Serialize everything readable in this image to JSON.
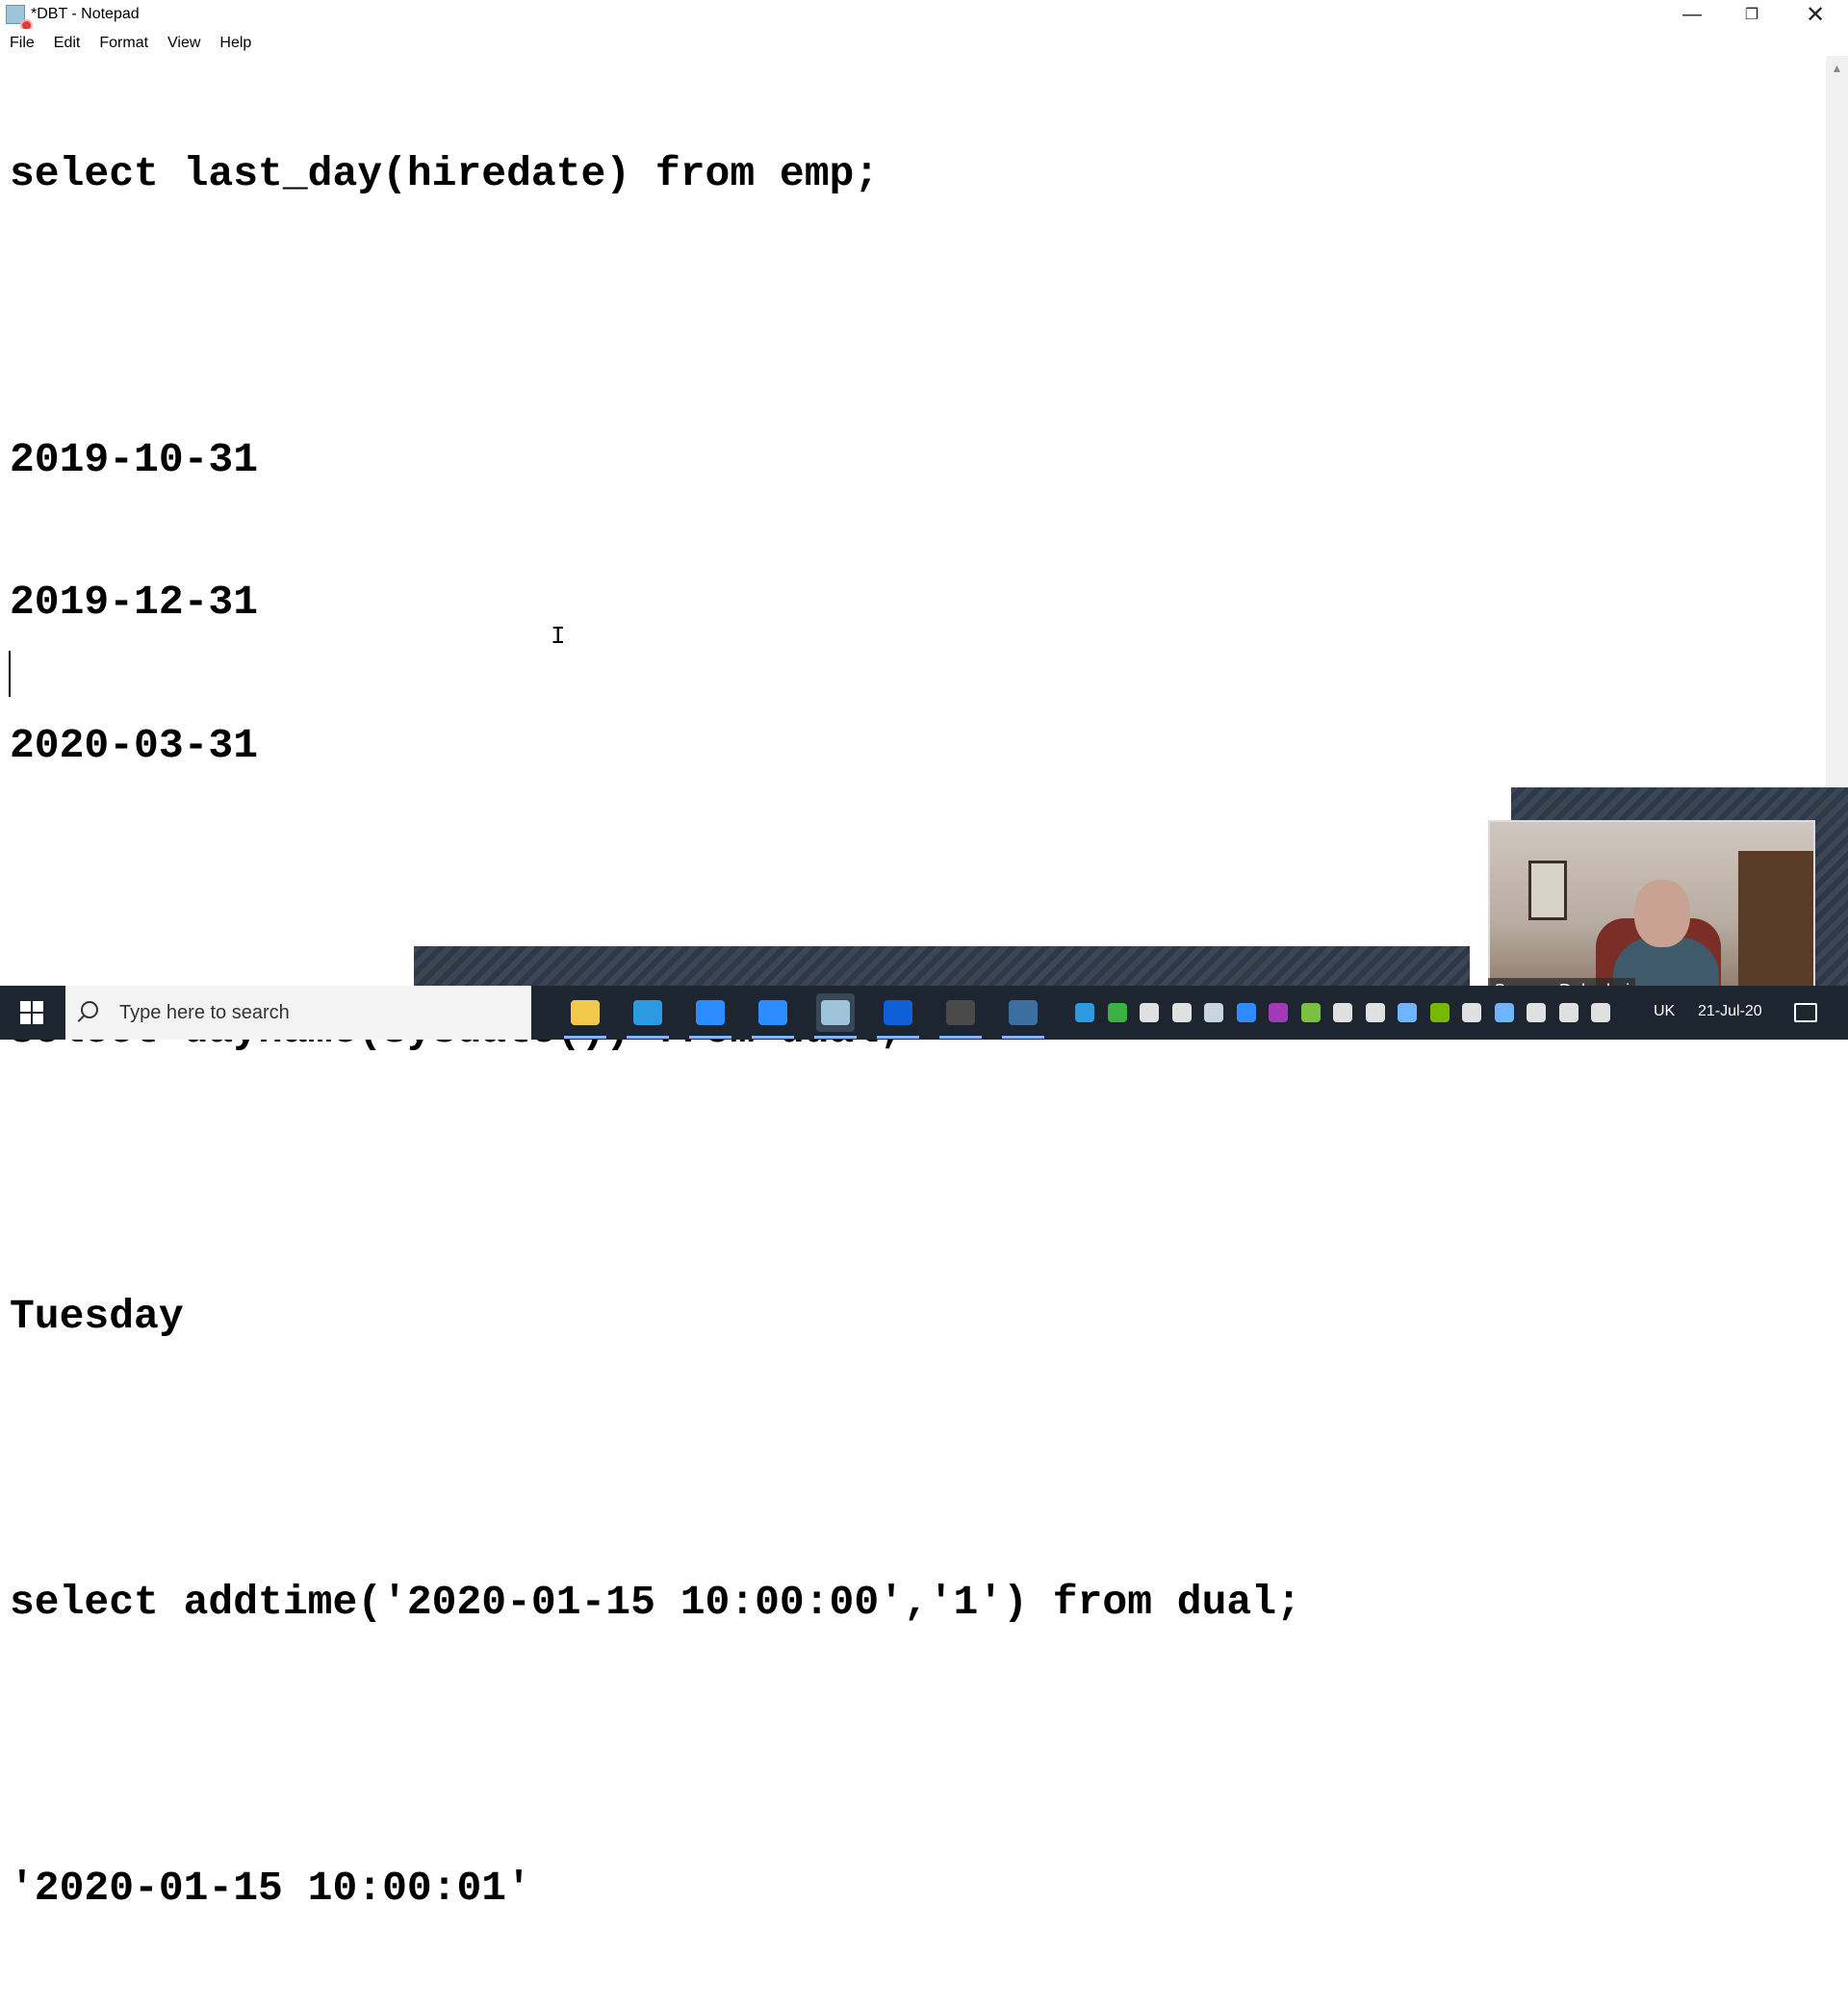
{
  "window": {
    "title": "*DBT - Notepad",
    "minimize_glyph": "—",
    "restore_glyph": "❐",
    "close_glyph": "✕"
  },
  "menu": [
    {
      "label": "File"
    },
    {
      "label": "Edit"
    },
    {
      "label": "Format"
    },
    {
      "label": "View"
    },
    {
      "label": "Help"
    }
  ],
  "editor": {
    "lines": [
      "select last_day(hiredate) from emp;",
      "",
      "2019-10-31",
      "2019-12-31",
      "2020-03-31",
      "",
      "select dayname(sysdate()) from dual;",
      "",
      "Tuesday",
      "",
      "select addtime('2020-01-15 10:00:00','1') from dual;",
      "",
      "'2020-01-15 10:00:01'"
    ]
  },
  "webcam": {
    "participant_name": "Sameer Dehadrai"
  },
  "taskbar": {
    "search_placeholder": "Type here to search",
    "apps": [
      {
        "icon": "file-explorer-icon",
        "color": "#f2c94c"
      },
      {
        "icon": "edge-icon",
        "color": "#2b9ae0"
      },
      {
        "icon": "zoom-icon",
        "color": "#2d8cff"
      },
      {
        "icon": "zoom-meetings-icon",
        "color": "#2d8cff"
      },
      {
        "icon": "notepad-icon",
        "color": "#9fc3d8",
        "active": true
      },
      {
        "icon": "whiteboard-icon",
        "color": "#0f5fd6"
      },
      {
        "icon": "sql-terminal-icon",
        "color": "#4a4a4a"
      },
      {
        "icon": "mysql-workbench-icon",
        "color": "#3b6fa0"
      }
    ],
    "tray_icons": [
      {
        "icon": "help-icon",
        "color": "#2b9ae0"
      },
      {
        "icon": "check-shield-icon",
        "color": "#3cb043"
      },
      {
        "icon": "microphone-icon",
        "color": "#e0e0e0"
      },
      {
        "icon": "battery-icon",
        "color": "#e0e0e0"
      },
      {
        "icon": "steam-icon",
        "color": "#c7d5e0"
      },
      {
        "icon": "zoom-tray-icon",
        "color": "#2d8cff"
      },
      {
        "icon": "onenote-icon",
        "color": "#a33ab5"
      },
      {
        "icon": "update-icon",
        "color": "#7ac143"
      },
      {
        "icon": "security-icon",
        "color": "#e0e0e0"
      },
      {
        "icon": "network-icon",
        "color": "#e0e0e0"
      },
      {
        "icon": "snowflake-icon",
        "color": "#6fb4ff"
      },
      {
        "icon": "nvidia-icon",
        "color": "#76b900"
      },
      {
        "icon": "tablet-icon",
        "color": "#e0e0e0"
      },
      {
        "icon": "pen-icon",
        "color": "#6fb4ff"
      },
      {
        "icon": "bluetooth-icon",
        "color": "#e0e0e0"
      },
      {
        "icon": "volume-icon",
        "color": "#e0e0e0"
      },
      {
        "icon": "wifi-icon",
        "color": "#e0e0e0"
      }
    ],
    "language": "UK",
    "date": "21-Jul-20"
  }
}
